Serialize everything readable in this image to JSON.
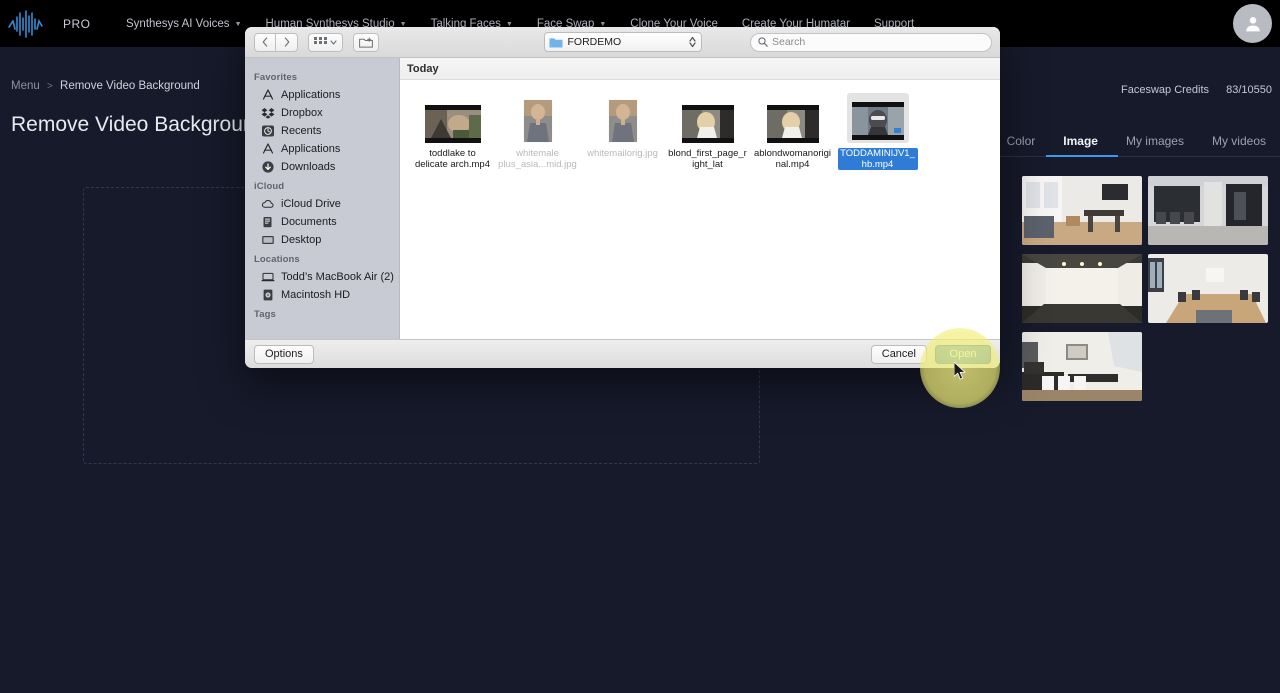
{
  "app": {
    "brand": {
      "name": "PRO",
      "logo_icon": "waveform-logo-icon",
      "accent": "#3d9ae8"
    },
    "nav": [
      {
        "label": "Synthesys AI Voices",
        "has_caret": true
      },
      {
        "label": "Human Synthesys Studio",
        "has_caret": true
      },
      {
        "label": "Talking Faces",
        "has_caret": true
      },
      {
        "label": "Face Swap",
        "has_caret": true
      },
      {
        "label": "Clone Your Voice",
        "has_caret": false
      },
      {
        "label": "Create Your Humatar",
        "has_caret": false
      },
      {
        "label": "Support",
        "has_caret": false
      }
    ],
    "avatar_icon": "user-avatar-icon"
  },
  "breadcrumb": {
    "root": "Menu",
    "separator": ">",
    "current": "Remove Video Background"
  },
  "page": {
    "title": "Remove Video Background"
  },
  "credits": {
    "label": "Faceswap Credits",
    "value": "83/10550"
  },
  "dropzone": {
    "hint": ""
  },
  "panel": {
    "tabs": [
      {
        "label": "Color",
        "active": false
      },
      {
        "label": "Image",
        "active": true
      },
      {
        "label": "My images",
        "active": false
      },
      {
        "label": "My videos",
        "active": false
      }
    ],
    "thumbnails": [
      {
        "name": "bright-loft-living-room"
      },
      {
        "name": "dark-modern-lobby"
      },
      {
        "name": "empty-white-room"
      },
      {
        "name": "conference-room-table"
      },
      {
        "name": "white-dining-room"
      }
    ]
  },
  "dialog": {
    "toolbar": {
      "back_icon": "chevron-left-icon",
      "forward_icon": "chevron-right-icon",
      "view_icon": "grid-view-icon",
      "view_caret_icon": "chevron-down-icon",
      "group_icon": "new-folder-icon",
      "path_folder_icon": "folder-icon",
      "path_label": "FORDEMO",
      "path_stepper_icon": "stepper-updown-icon",
      "search_icon": "search-icon",
      "search_placeholder": "Search",
      "search_value": ""
    },
    "sidebar": [
      {
        "header": "Favorites",
        "items": [
          {
            "label": "Applications",
            "icon": "applications-icon"
          },
          {
            "label": "Dropbox",
            "icon": "dropbox-icon"
          },
          {
            "label": "Recents",
            "icon": "recents-clock-icon"
          },
          {
            "label": "Applications",
            "icon": "applications-icon"
          },
          {
            "label": "Downloads",
            "icon": "downloads-arrow-icon"
          }
        ]
      },
      {
        "header": "iCloud",
        "items": [
          {
            "label": "iCloud Drive",
            "icon": "cloud-icon"
          },
          {
            "label": "Documents",
            "icon": "documents-icon"
          },
          {
            "label": "Desktop",
            "icon": "desktop-icon"
          }
        ]
      },
      {
        "header": "Locations",
        "items": [
          {
            "label": "Todd’s MacBook Air (2)",
            "icon": "laptop-icon"
          },
          {
            "label": "Macintosh HD",
            "icon": "harddrive-icon"
          }
        ]
      },
      {
        "header": "Tags",
        "items": []
      }
    ],
    "group_header": "Today",
    "files": [
      {
        "name": "toddlake to delicate arch.mp4",
        "kind": "video",
        "selected": false,
        "dim": false
      },
      {
        "name": "whitemale plus_asia...mid.jpg",
        "kind": "portrait-image",
        "selected": false,
        "dim": true
      },
      {
        "name": "whitemailorig.jpg",
        "kind": "portrait-image",
        "selected": false,
        "dim": true
      },
      {
        "name": "blond_first_page_right_lat",
        "kind": "video",
        "selected": false,
        "dim": false
      },
      {
        "name": "ablondwomanoriginal.mp4",
        "kind": "video",
        "selected": false,
        "dim": false
      },
      {
        "name": "TODDAMINIJV1_hb.mp4",
        "kind": "video",
        "selected": true,
        "dim": false
      }
    ],
    "footer": {
      "options_label": "Options",
      "cancel_label": "Cancel",
      "open_label": "Open"
    }
  },
  "cursor": {
    "icon": "mouse-pointer-icon",
    "highlight_color": "#f2ef82"
  }
}
